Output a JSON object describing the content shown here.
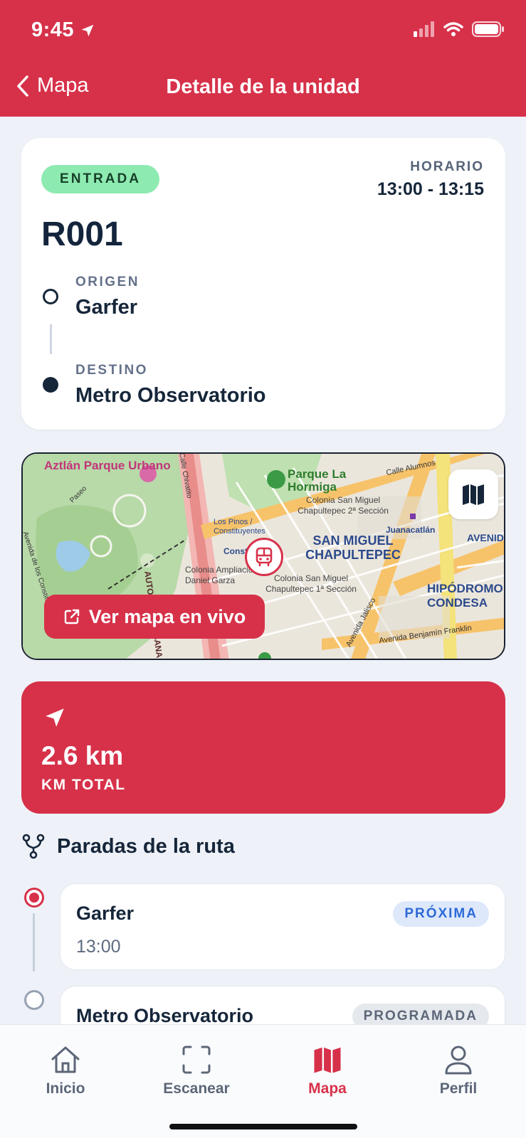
{
  "status": {
    "time": "9:45"
  },
  "nav": {
    "back_label": "Mapa",
    "title": "Detalle de la unidad"
  },
  "unit": {
    "type_badge": "ENTRADA",
    "schedule_label": "HORARIO",
    "schedule_value": "13:00 - 13:15",
    "route_code": "R001",
    "origin_label": "ORIGEN",
    "origin_value": "Garfer",
    "destination_label": "DESTINO",
    "destination_value": "Metro Observatorio"
  },
  "map": {
    "live_button_label": "Ver mapa en vivo",
    "labels": {
      "park_aztlan": "Aztlán Parque Urbano",
      "park_hormiga": "Parque La Hormiga",
      "col_san_miguel_2": "Colonia San Miguel Chapultepec 2ª Sección",
      "juanacatlan": "Juanacatlán",
      "san_miguel": "SAN MIGUEL CHAPULTEPEC",
      "col_san_miguel_1": "Colonia San Miguel Chapultepec 1ª Sección",
      "pinos": "Los Pinos / Constituyentes",
      "ampliacion": "Colonia Ampliación Daniel Garza",
      "hipodromo": "HIPÓDROMO CONDESA",
      "autopista": "AUTOPISTA URBANA NORTE",
      "av_jalisco": "Avenida Jalisco",
      "av_benjamin": "Avenida Benjamín Franklin",
      "calle_alumnos": "Calle Alumnos",
      "av_constituyentes": "Avenida de los Constituyentes",
      "paseo": "Paseo",
      "chivatito": "Calle Chivatito",
      "avenida": "AVENIDA",
      "constitu": "Constitu"
    }
  },
  "distance": {
    "value": "2.6 km",
    "label": "KM TOTAL"
  },
  "stops_section": {
    "title": "Paradas de la ruta",
    "stops": [
      {
        "name": "Garfer",
        "time": "13:00",
        "status": "PRÓXIMA"
      },
      {
        "name": "Metro Observatorio",
        "status": "PROGRAMADA"
      }
    ]
  },
  "tabbar": {
    "items": [
      {
        "label": "Inicio",
        "icon": "home-icon"
      },
      {
        "label": "Escanear",
        "icon": "scan-icon"
      },
      {
        "label": "Mapa",
        "icon": "map-icon"
      },
      {
        "label": "Perfil",
        "icon": "profile-icon"
      }
    ],
    "active": "Mapa"
  },
  "colors": {
    "brand": "#d7314a",
    "badge_green": "#8deab0",
    "pill_blue": "#2d6ad6",
    "text_dark": "#16263a"
  }
}
